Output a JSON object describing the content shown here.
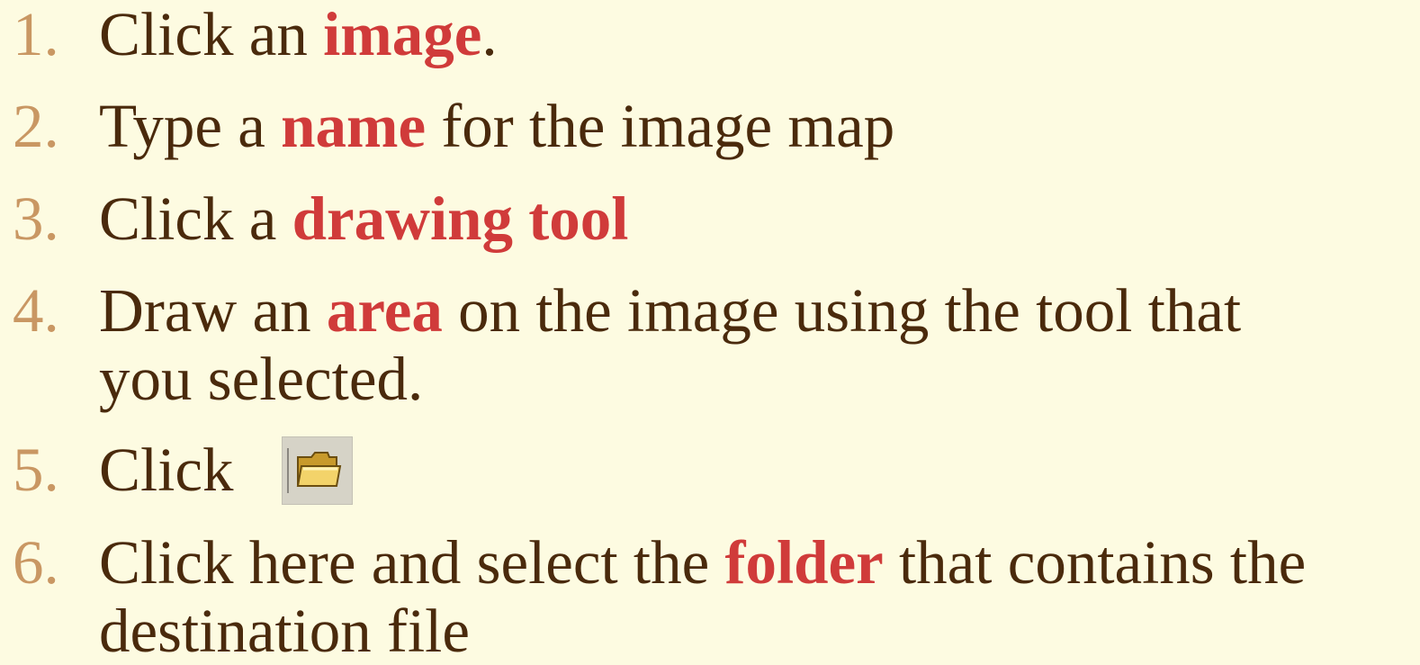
{
  "steps": [
    {
      "num": "1.",
      "parts": [
        "Click an ",
        "image",
        "."
      ]
    },
    {
      "num": "2.",
      "parts": [
        "Type a ",
        "name",
        " for the image map"
      ]
    },
    {
      "num": "3.",
      "parts": [
        "Click a ",
        "drawing tool",
        ""
      ]
    },
    {
      "num": "4.",
      "parts": [
        "Draw an ",
        "area",
        " on the image using the tool that",
        "you selected."
      ]
    },
    {
      "num": "5.",
      "parts": [
        "Click"
      ]
    },
    {
      "num": "6.",
      "parts": [
        "Click here and select the ",
        "folder",
        " that contains the",
        "destination file"
      ]
    }
  ],
  "colors": {
    "background": "#fdfbe1",
    "text": "#4a2a0c",
    "number": "#c99763",
    "highlight": "#d03b3a"
  },
  "icons": {
    "open_folder": "folder-icon"
  }
}
